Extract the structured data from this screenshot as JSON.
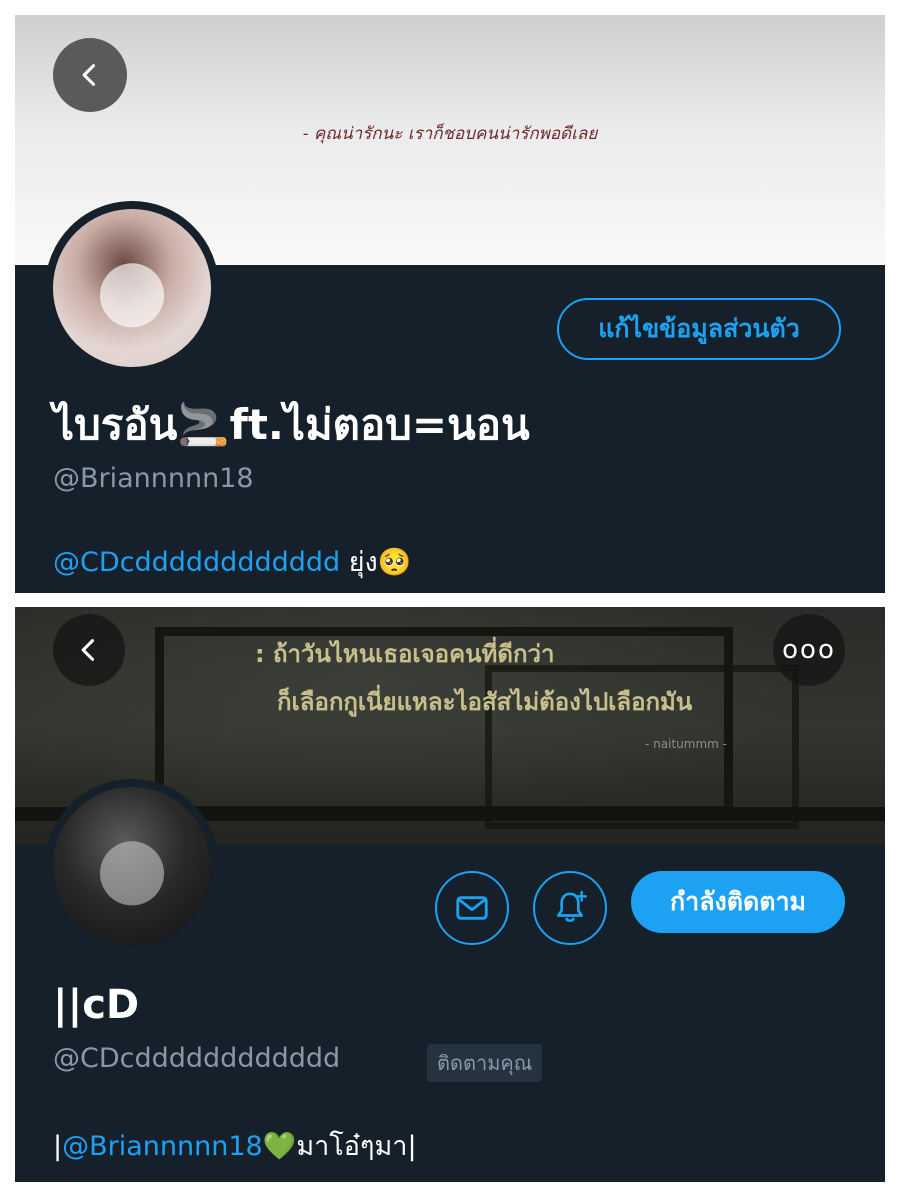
{
  "profile_own": {
    "banner_quote": "- คุณน่ารักนะ เราก็ชอบคนน่ารักพอดีเลย",
    "edit_button": "แก้ไขข้อมูลส่วนตัว",
    "display_name": "ไบรอัน🚬ft.ไม่ตอบ=นอน",
    "handle": "@Briannnnn18",
    "bio_mention": "@CDcdddddddddddd",
    "bio_text": " ยุ่ง🥺"
  },
  "profile_other": {
    "banner_quote_line1": ": ถ้าวันไหนเธอเจอคนที่ดีกว่า",
    "banner_quote_line2": "ก็เลือกกูเนี่ยแหละไอสัสไม่ต้องไปเลือกมัน",
    "banner_credit": "- naitummm -",
    "follow_button": "กำลังติดตาม",
    "display_name": "||cD",
    "handle": "@CDcdddddddddddd",
    "follows_you_badge": "ติดตามคุณ",
    "bio_prefix": "|",
    "bio_mention": "@Briannnnn18",
    "bio_text": "💚มาโอ๋ๆมา|"
  },
  "icons": {
    "back": "chevron-left-icon",
    "more": "more-icon",
    "message": "mail-icon",
    "notifications": "bell-plus-icon",
    "avatar": "avatar-icon"
  },
  "colors": {
    "background": "#15202b",
    "accent": "#1da1f2",
    "secondary_text": "#8899a6"
  }
}
